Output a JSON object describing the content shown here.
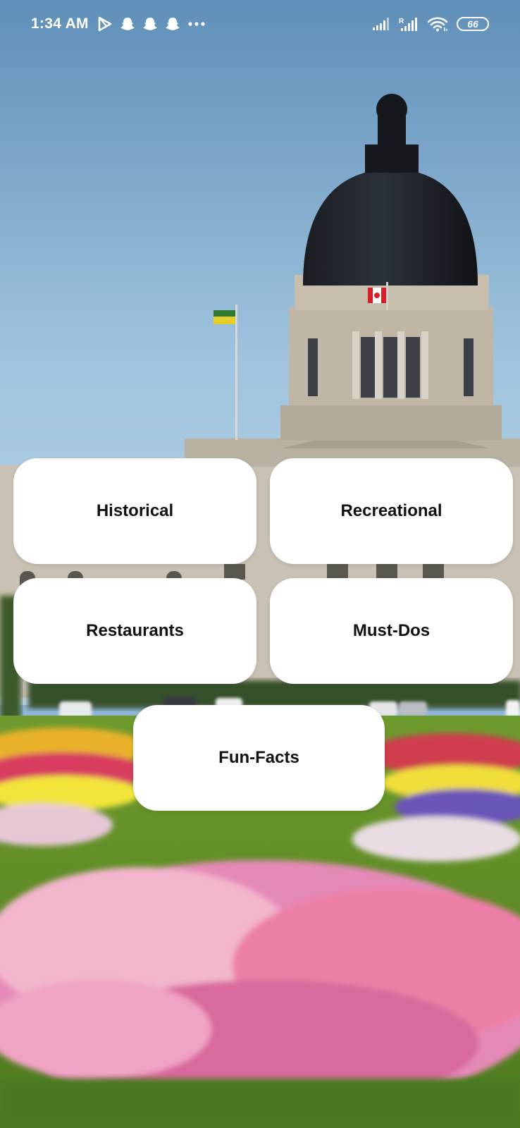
{
  "status_bar": {
    "time": "1:34 AM",
    "notification_icons": [
      "play-store-icon",
      "snapchat-icon",
      "snapchat-icon",
      "snapchat-icon",
      "more-dots-icon"
    ],
    "right_icons": [
      "signal-icon",
      "signal-roaming-icon",
      "wifi-icon"
    ],
    "roaming_label": "R",
    "battery_level": "66"
  },
  "menu": {
    "historical": "Historical",
    "recreational": "Recreational",
    "restaurants": "Restaurants",
    "must_dos": "Must-Dos",
    "fun_facts": "Fun-Facts"
  },
  "colors": {
    "button_bg": "#ffffff",
    "button_text": "#111111",
    "status_text": "#ffffff"
  }
}
